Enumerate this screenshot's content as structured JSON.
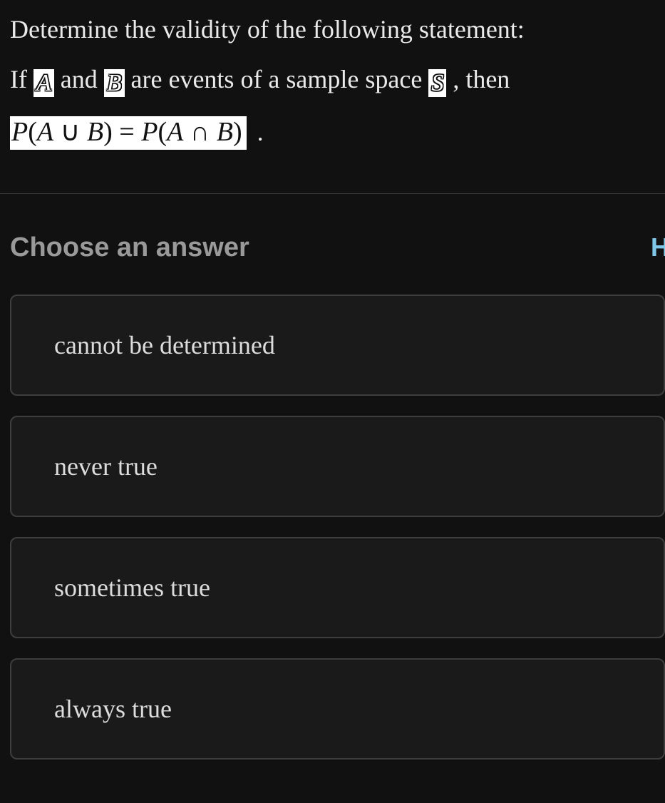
{
  "prompt": {
    "intro": "Determine the validity of the following statement:",
    "line2_pre": "If ",
    "var_a": "A",
    "line2_mid1": " and ",
    "var_b": "B",
    "line2_mid2": " are events of a sample space ",
    "var_s": "S",
    "line2_post": ", then",
    "formula": "P(A ∪ B) = P(A ∩ B)",
    "period": "."
  },
  "choose_label": "Choose an answer",
  "hint_fragment": "H",
  "answers": [
    {
      "label": "cannot be determined"
    },
    {
      "label": "never true"
    },
    {
      "label": "sometimes true"
    },
    {
      "label": "always true"
    }
  ]
}
